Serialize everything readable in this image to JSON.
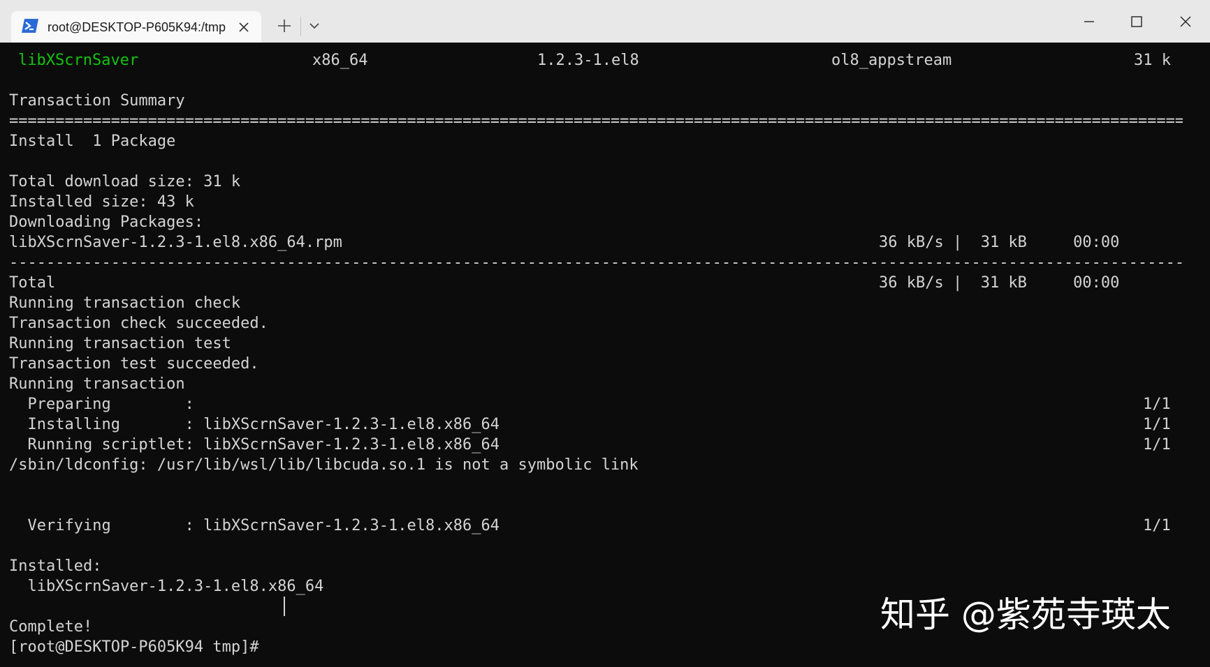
{
  "window": {
    "tab_title": "root@DESKTOP-P605K94:/tmp",
    "icons": {
      "tab": "powershell-icon",
      "tab_close": "close-icon",
      "new_tab": "plus-icon",
      "dropdown": "chevron-down-icon",
      "minimize": "minimize-icon",
      "maximize": "maximize-icon",
      "close": "close-icon"
    }
  },
  "terminal": {
    "pkg_row": {
      "name": "libXScrnSaver",
      "arch": "x86_64",
      "version": "1.2.3-1.el8",
      "repo": "ol8_appstream",
      "size": "31 k"
    },
    "transaction_summary": "Transaction Summary",
    "separator_equals": "================================================================================================================================",
    "install_line": "Install  1 Package",
    "total_download": "Total download size: 31 k",
    "installed_size": "Installed size: 43 k",
    "downloading": "Downloading Packages:",
    "download_file": {
      "name": "libXScrnSaver-1.2.3-1.el8.x86_64.rpm",
      "stats": "36 kB/s |  31 kB     00:00"
    },
    "separator_dashes": "--------------------------------------------------------------------------------------------------------------------------------",
    "total": {
      "label": "Total",
      "stats": "36 kB/s |  31 kB     00:00"
    },
    "running_check": "Running transaction check",
    "check_succeeded": "Transaction check succeeded.",
    "running_test": "Running transaction test",
    "test_succeeded": "Transaction test succeeded.",
    "running_transaction": "Running transaction",
    "steps": [
      {
        "text": "  Preparing        :",
        "count": "1/1"
      },
      {
        "text": "  Installing       : libXScrnSaver-1.2.3-1.el8.x86_64",
        "count": "1/1"
      },
      {
        "text": "  Running scriptlet: libXScrnSaver-1.2.3-1.el8.x86_64",
        "count": "1/1"
      }
    ],
    "ldconfig_warning": "/sbin/ldconfig: /usr/lib/wsl/lib/libcuda.so.1 is not a symbolic link",
    "verifying": {
      "text": "  Verifying        : libXScrnSaver-1.2.3-1.el8.x86_64",
      "count": "1/1"
    },
    "installed_label": "Installed:",
    "installed_pkg": "  libXScrnSaver-1.2.3-1.el8.x86_64",
    "complete": "Complete!",
    "prompt": "[root@DESKTOP-P605K94 tmp]# "
  },
  "watermark": "知乎 @紫苑寺瑛太",
  "colors": {
    "terminal_bg": "#0c0c0c",
    "terminal_fg": "#d4d4d4",
    "package_green": "#13c40e",
    "titlebar_bg": "#e8e8e8"
  }
}
